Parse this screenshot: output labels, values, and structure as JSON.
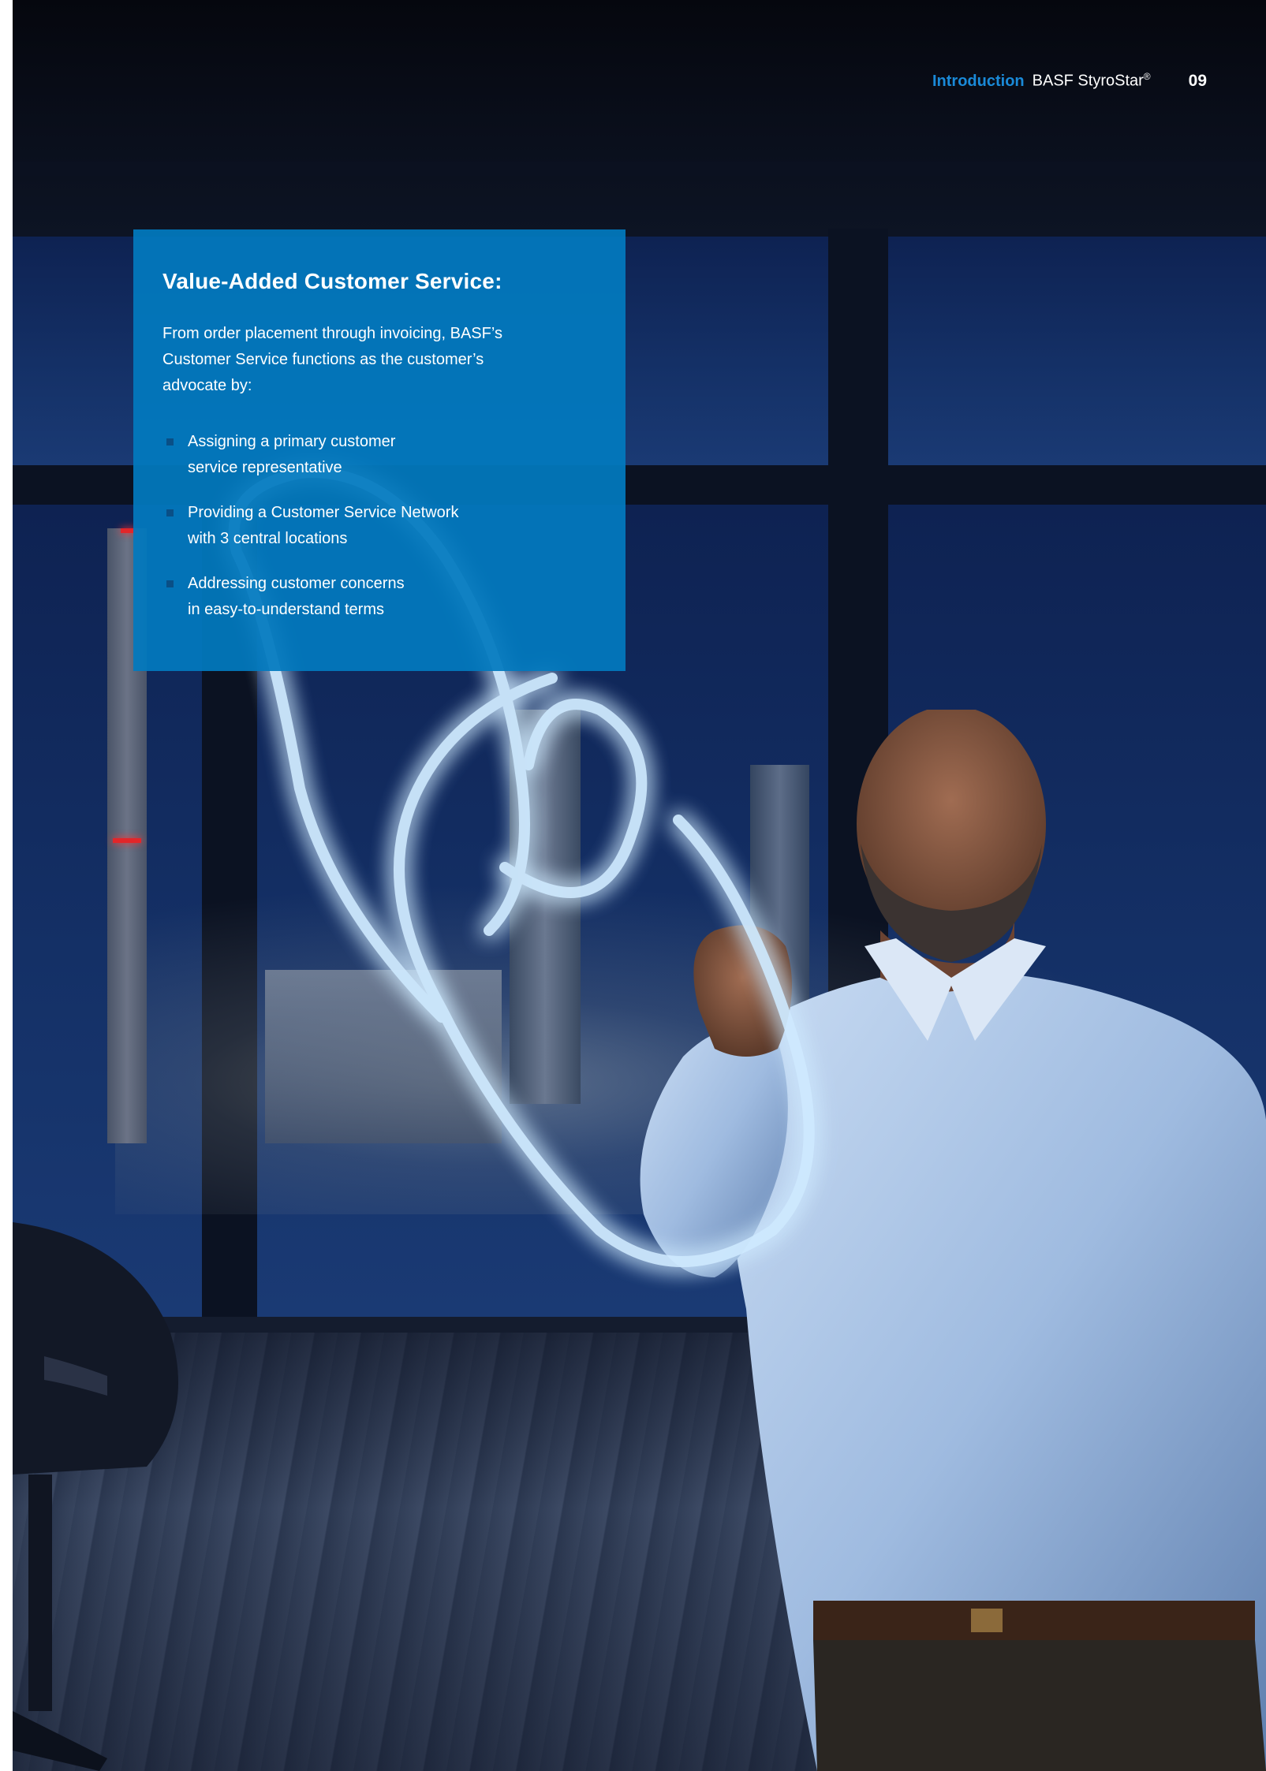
{
  "header": {
    "section": "Introduction",
    "publication": "BASF StyroStar",
    "registered": "®",
    "page_number": "09"
  },
  "card": {
    "title": "Value-Added Customer Service:",
    "intro_lines": [
      "From order placement through invoicing, BASF’s",
      "Customer Service functions as the customer’s",
      "advocate by:"
    ],
    "items": [
      {
        "lines": [
          "Assigning a primary customer",
          "service representative"
        ]
      },
      {
        "lines": [
          "Providing a Customer Service Network",
          "with 3 central locations"
        ]
      },
      {
        "lines": [
          "Addressing customer concerns",
          "in easy-to-understand terms"
        ]
      }
    ]
  },
  "colors": {
    "card_blue": "#027abe",
    "accent_blue": "#1a8ad8",
    "bullet": "#0a4f86",
    "glow": "#5ab8ff"
  },
  "photo": {
    "icons": [
      "glowing-chain-link-icon"
    ]
  }
}
